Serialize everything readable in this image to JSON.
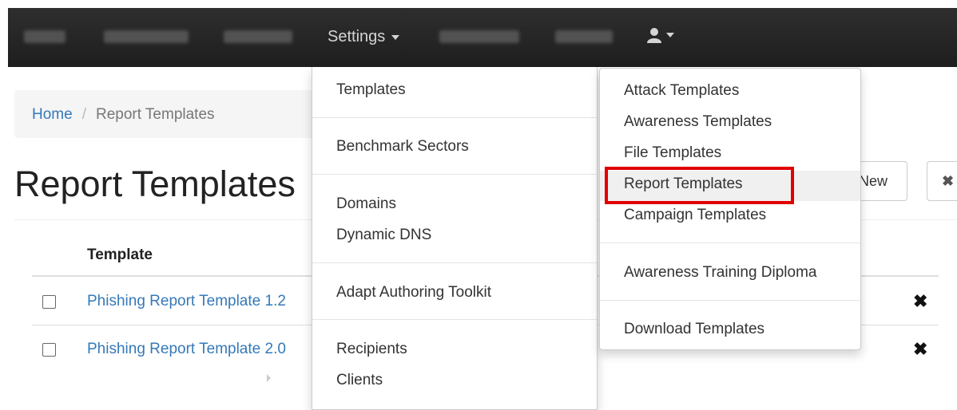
{
  "navbar": {
    "settings_label": "Settings",
    "user_icon": "user-icon"
  },
  "breadcrumb": {
    "home": "Home",
    "separator": "/",
    "current": "Report Templates"
  },
  "page": {
    "title": "Report Templates",
    "new_button": "New",
    "delete_button": "✖"
  },
  "table": {
    "header_template": "Template",
    "rows": [
      {
        "name": "Phishing Report Template 1.2",
        "delete": "✖"
      },
      {
        "name": "Phishing Report Template 2.0",
        "delete": "✖"
      }
    ]
  },
  "settings_menu": {
    "items": [
      "Templates",
      "Benchmark Sectors",
      "Domains",
      "Dynamic DNS",
      "Adapt Authoring Toolkit",
      "Recipients",
      "Clients"
    ]
  },
  "templates_submenu": {
    "items": [
      "Attack Templates",
      "Awareness Templates",
      "File Templates",
      "Report Templates",
      "Campaign Templates",
      "Awareness Training Diploma",
      "Download Templates"
    ]
  },
  "colors": {
    "navbar": "#222222",
    "link": "#3579b8",
    "highlight": "#e00000"
  }
}
